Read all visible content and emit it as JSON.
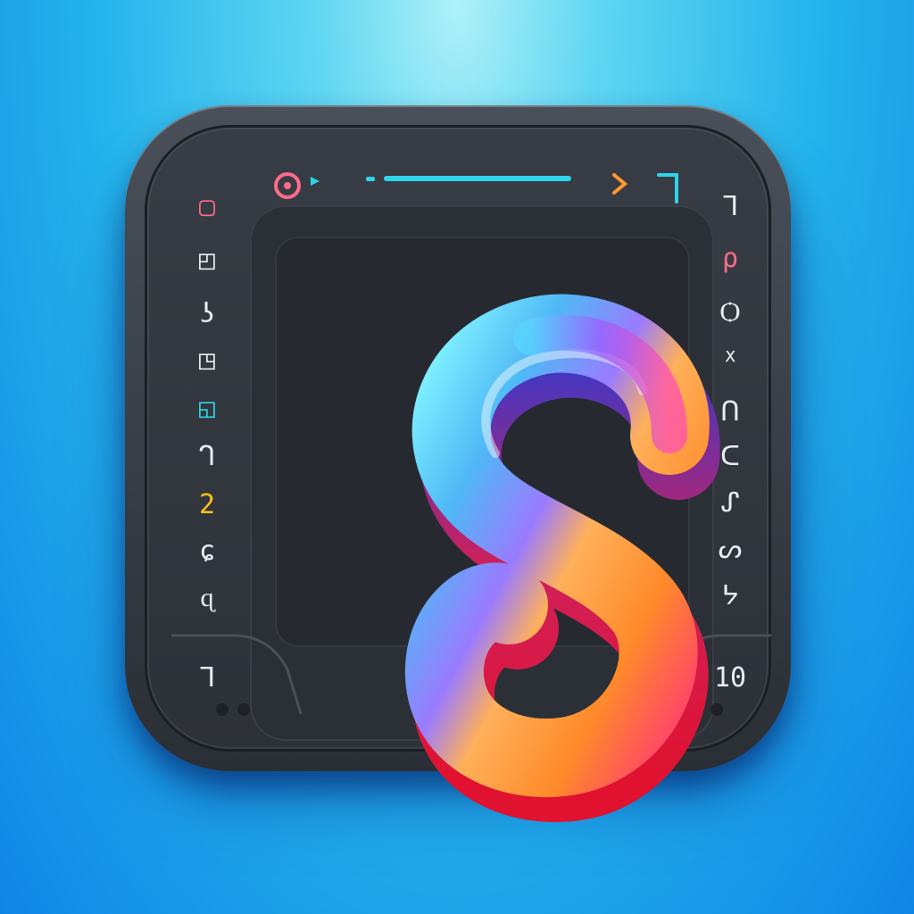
{
  "app_icon": {
    "monogram": "S",
    "colors": {
      "background_top": "#aef1f8",
      "background_bottom": "#0e86e6",
      "frame": "#2a2e35",
      "accent_cyan": "#2fd3ea",
      "accent_pink": "#ff5f8f",
      "accent_orange": "#ff9a2e",
      "accent_yellow": "#ffc21a"
    }
  },
  "toolbar": {
    "icons": [
      {
        "name": "record-icon",
        "color": "#ff6b8a"
      },
      {
        "name": "play-icon",
        "color": "#2fd3ea"
      },
      {
        "name": "progress-bar-icon",
        "color": "#2fd3ea"
      },
      {
        "name": "chevron-right-icon",
        "color": "#ff9a2e"
      },
      {
        "name": "corner-bracket-icon",
        "color": "#2fd3ea"
      }
    ]
  },
  "left_rail": {
    "glyphs": [
      "▢",
      "◰",
      "ʖ",
      "◳",
      "◱",
      "ᒉ",
      "2",
      "ɕ",
      "ɋ",
      "ᒣ"
    ]
  },
  "right_rail": {
    "glyphs": [
      "ᒣ",
      "ρ",
      "Ѻ",
      "ᕽ",
      "ᑎ",
      "ᑕ",
      "ᔑ",
      "ᔕ",
      "ᔭ",
      "10"
    ]
  }
}
